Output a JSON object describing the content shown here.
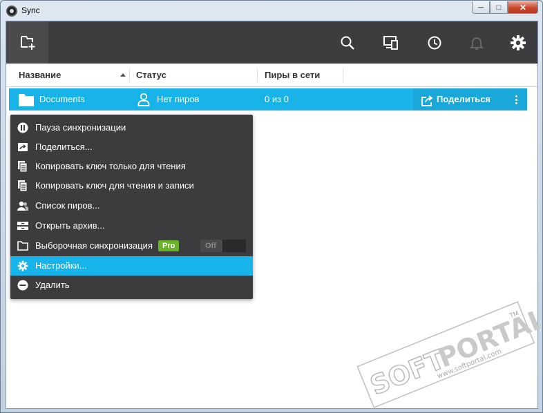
{
  "window": {
    "title": "Sync",
    "minimize_glyph": "─",
    "maximize_glyph": "□",
    "close_glyph": "✕"
  },
  "toolbar": {
    "icons": [
      "add-folder-icon",
      "search-icon",
      "devices-icon",
      "history-icon",
      "notifications-icon",
      "settings-icon"
    ]
  },
  "columns": {
    "name": "Название",
    "status": "Статус",
    "peers": "Пиры в сети"
  },
  "folder": {
    "name": "Documents",
    "status": "Нет пиров",
    "peers": "0 из 0",
    "share_label": "Поделиться"
  },
  "context_menu": {
    "items": [
      {
        "label": "Пауза синхронизации",
        "icon": "pause-icon"
      },
      {
        "label": "Поделиться...",
        "icon": "share-icon"
      },
      {
        "label": "Копировать ключ только для чтения",
        "icon": "copy-icon"
      },
      {
        "label": "Копировать ключ для чтения и записи",
        "icon": "copy-icon"
      },
      {
        "label": "Список пиров...",
        "icon": "peers-icon"
      },
      {
        "label": "Открыть архив...",
        "icon": "archive-icon"
      },
      {
        "label": "Выборочная синхронизация",
        "icon": "folder-icon",
        "badge": "Pro",
        "toggle": "Off"
      },
      {
        "label": "Настройки...",
        "icon": "gear-icon",
        "active": true
      },
      {
        "label": "Удалить",
        "icon": "remove-icon"
      }
    ]
  },
  "colors": {
    "accent": "#18b4e9",
    "toolbar": "#3d3d3f",
    "menu": "#3c3c3e",
    "pro": "#6bb42a"
  },
  "watermark": {
    "brand_left": "SOFT",
    "brand_right": "PORTAL",
    "tm": "TM",
    "url": "www.softportal.com"
  }
}
